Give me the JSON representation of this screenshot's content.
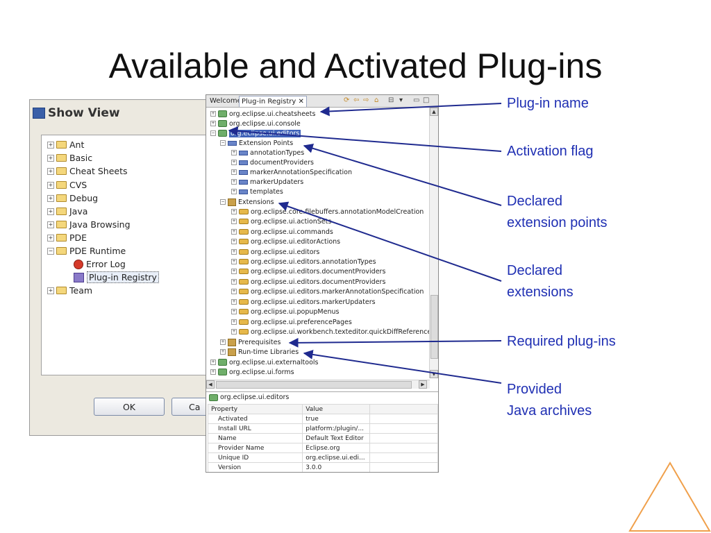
{
  "slide": {
    "title": "Available and Activated Plug-ins"
  },
  "show_view": {
    "title": "Show View",
    "items": [
      {
        "label": "Ant"
      },
      {
        "label": "Basic"
      },
      {
        "label": "Cheat Sheets"
      },
      {
        "label": "CVS"
      },
      {
        "label": "Debug"
      },
      {
        "label": "Java"
      },
      {
        "label": "Java Browsing"
      },
      {
        "label": "PDE"
      },
      {
        "label": "PDE Runtime"
      },
      {
        "label": "Error Log"
      },
      {
        "label": "Plug-in Registry"
      },
      {
        "label": "Team"
      }
    ],
    "ok_label": "OK",
    "cancel_label": "Ca"
  },
  "registry": {
    "tabs": {
      "welcome": "Welcome",
      "active": "Plug-in Registry"
    },
    "rows": [
      "org.eclipse.ui.cheatsheets",
      "org.eclipse.ui.console",
      "org.eclipse.ui.editors",
      "Extension Points",
      "annotationTypes",
      "documentProviders",
      "markerAnnotationSpecification",
      "markerUpdaters",
      "templates",
      "Extensions",
      "org.eclipse.core.filebuffers.annotationModelCreation",
      "org.eclipse.ui.actionSets",
      "org.eclipse.ui.commands",
      "org.eclipse.ui.editorActions",
      "org.eclipse.ui.editors",
      "org.eclipse.ui.editors.annotationTypes",
      "org.eclipse.ui.editors.documentProviders",
      "org.eclipse.ui.editors.documentProviders",
      "org.eclipse.ui.editors.markerAnnotationSpecification",
      "org.eclipse.ui.editors.markerUpdaters",
      "org.eclipse.ui.popupMenus",
      "org.eclipse.ui.preferencePages",
      "org.eclipse.ui.workbench.texteditor.quickDiffReferenceF",
      "Prerequisites",
      "Run-time Libraries",
      "org.eclipse.ui.externaltools",
      "org.eclipse.ui.forms"
    ],
    "selected_plugin": "org.eclipse.ui.editors",
    "properties": {
      "header_property": "Property",
      "header_value": "Value",
      "rows": [
        {
          "p": "Activated",
          "v": "true"
        },
        {
          "p": "Install URL",
          "v": "platform:/plugin/..."
        },
        {
          "p": "Name",
          "v": "Default Text Editor"
        },
        {
          "p": "Provider Name",
          "v": "Eclipse.org"
        },
        {
          "p": "Unique ID",
          "v": "org.eclipse.ui.edi..."
        },
        {
          "p": "Version",
          "v": "3.0.0"
        }
      ]
    }
  },
  "callouts": {
    "plugin_name": "Plug-in name",
    "activation_flag": "Activation flag",
    "declared_ext_points_1": "Declared",
    "declared_ext_points_2": "extension points",
    "declared_extensions_1": "Declared",
    "declared_extensions_2": "extensions",
    "required_plugins": "Required plug-ins",
    "provided_java_1": "Provided",
    "provided_java_2": "Java archives"
  },
  "colors": {
    "callout": "#1f2fb3",
    "arrow": "#1f2a8f",
    "triangle": "#f0a04b"
  }
}
